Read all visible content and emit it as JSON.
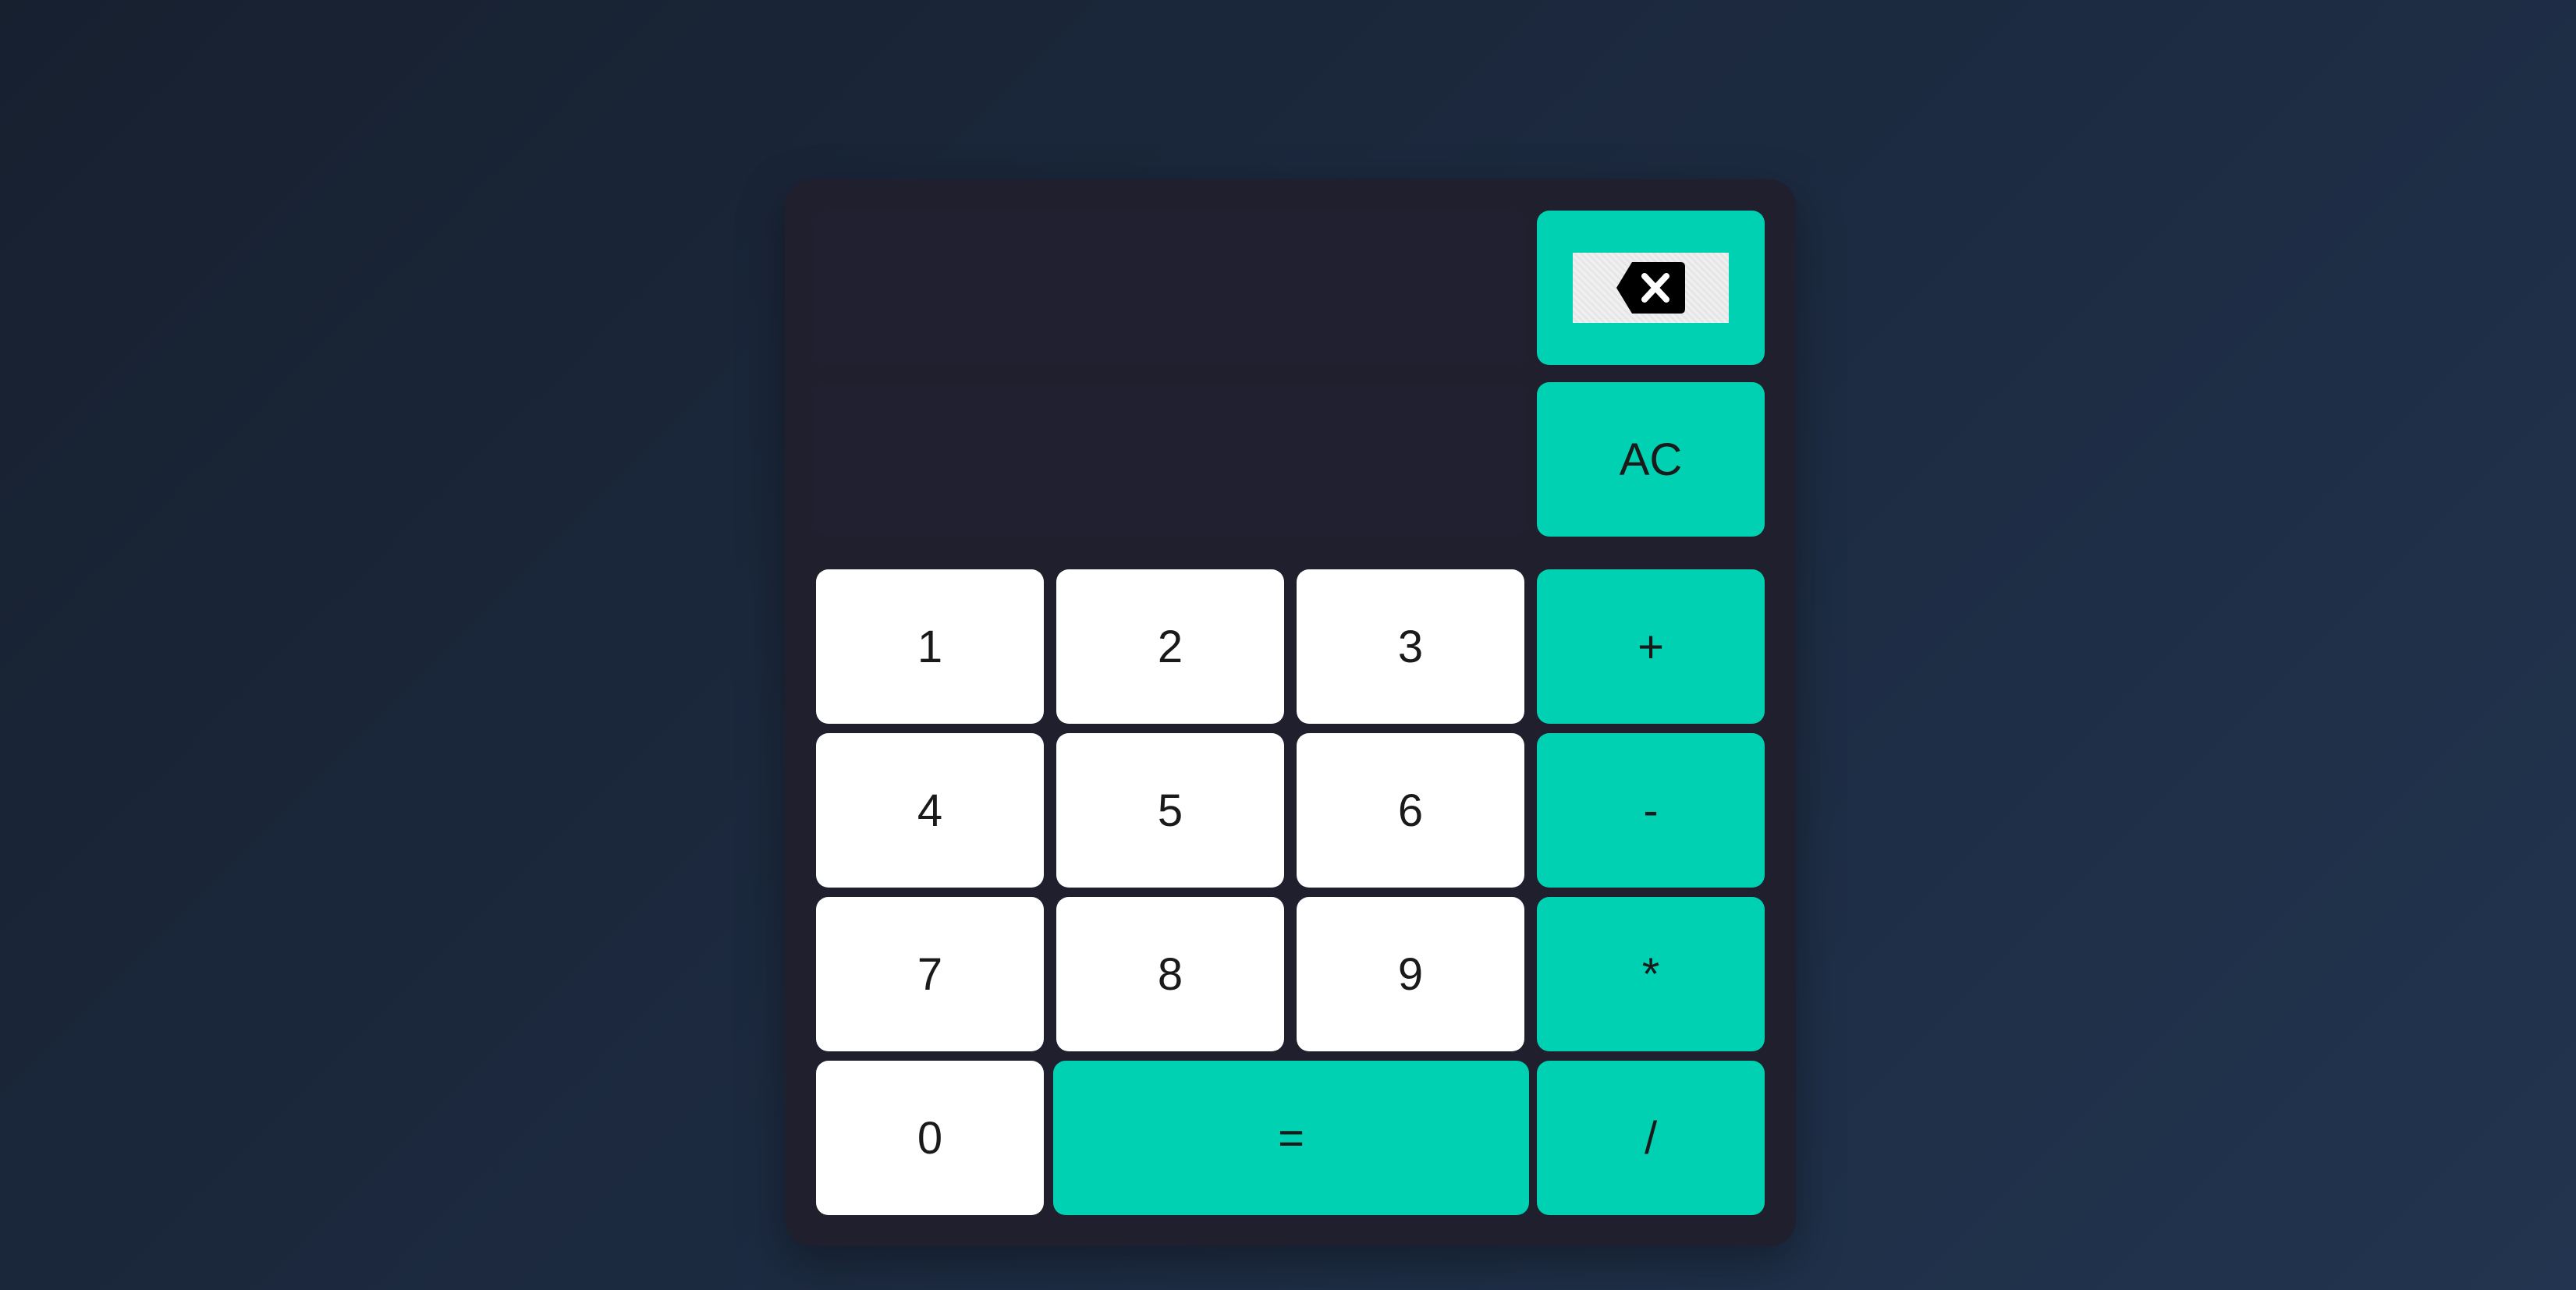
{
  "display": {
    "previous": "",
    "current": ""
  },
  "keys": {
    "backspace": "backspace-icon",
    "clear": "AC",
    "one": "1",
    "two": "2",
    "three": "3",
    "plus": "+",
    "four": "4",
    "five": "5",
    "six": "6",
    "minus": "-",
    "seven": "7",
    "eight": "8",
    "nine": "9",
    "multiply": "*",
    "zero": "0",
    "equals": "=",
    "divide": "/"
  },
  "colors": {
    "accent": "#00d1b2",
    "panel": "#1f1f2e",
    "number_key": "#ffffff"
  }
}
